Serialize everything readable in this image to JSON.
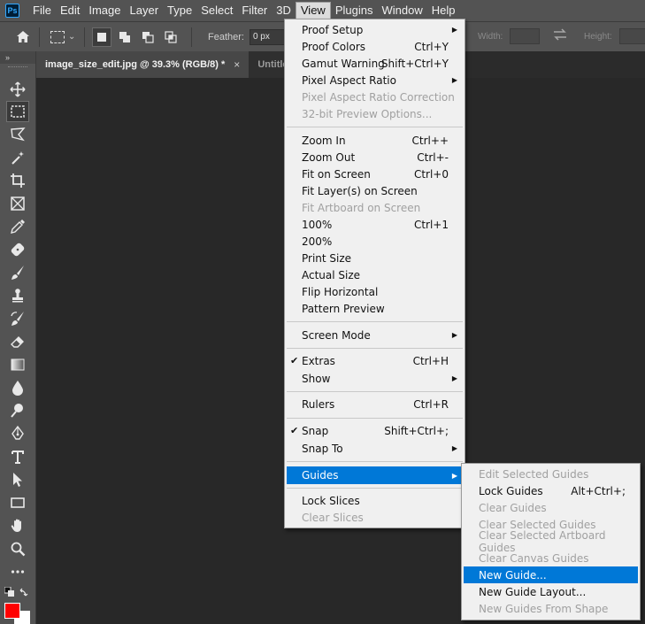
{
  "app": {
    "logo": "Ps"
  },
  "menubar": {
    "items": [
      "File",
      "Edit",
      "Image",
      "Layer",
      "Type",
      "Select",
      "Filter",
      "3D",
      "View",
      "Plugins",
      "Window",
      "Help"
    ]
  },
  "options": {
    "feather_label": "Feather:",
    "feather_value": "0 px",
    "width_label": "Width:",
    "height_label": "Height:"
  },
  "tabs": [
    {
      "label": "image_size_edit.jpg @ 39.3% (RGB/8) *",
      "close": "×"
    },
    {
      "label": "Untitled"
    }
  ],
  "toolbar": {
    "collapse": "»",
    "foreground_color": "#ff0000",
    "background_color": "#ffffff"
  },
  "view_menu": {
    "items": [
      {
        "label": "Proof Setup",
        "shortcut": "",
        "submenu": true
      },
      {
        "label": "Proof Colors",
        "shortcut": "Ctrl+Y"
      },
      {
        "label": "Gamut Warning",
        "shortcut": "Shift+Ctrl+Y"
      },
      {
        "label": "Pixel Aspect Ratio",
        "shortcut": "",
        "submenu": true
      },
      {
        "label": "Pixel Aspect Ratio Correction",
        "shortcut": "",
        "disabled": true
      },
      {
        "label": "32-bit Preview Options...",
        "shortcut": "",
        "disabled": true
      },
      {
        "label": "Zoom In",
        "shortcut": "Ctrl++"
      },
      {
        "label": "Zoom Out",
        "shortcut": "Ctrl+-"
      },
      {
        "label": "Fit on Screen",
        "shortcut": "Ctrl+0"
      },
      {
        "label": "Fit Layer(s) on Screen",
        "shortcut": ""
      },
      {
        "label": "Fit Artboard on Screen",
        "shortcut": "",
        "disabled": true
      },
      {
        "label": "100%",
        "shortcut": "Ctrl+1"
      },
      {
        "label": "200%",
        "shortcut": ""
      },
      {
        "label": "Print Size",
        "shortcut": ""
      },
      {
        "label": "Actual Size",
        "shortcut": ""
      },
      {
        "label": "Flip Horizontal",
        "shortcut": ""
      },
      {
        "label": "Pattern Preview",
        "shortcut": ""
      },
      {
        "label": "Screen Mode",
        "shortcut": "",
        "submenu": true
      },
      {
        "label": "Extras",
        "shortcut": "Ctrl+H",
        "checked": true
      },
      {
        "label": "Show",
        "shortcut": "",
        "submenu": true
      },
      {
        "label": "Rulers",
        "shortcut": "Ctrl+R"
      },
      {
        "label": "Snap",
        "shortcut": "Shift+Ctrl+;",
        "checked": true
      },
      {
        "label": "Snap To",
        "shortcut": "",
        "submenu": true
      },
      {
        "label": "Guides",
        "shortcut": "",
        "submenu": true,
        "highlighted": true
      },
      {
        "label": "Lock Slices",
        "shortcut": ""
      },
      {
        "label": "Clear Slices",
        "shortcut": "",
        "disabled": true
      }
    ],
    "check_glyph": "✔",
    "submenu_glyph": "▶"
  },
  "guides_submenu": {
    "items": [
      {
        "label": "Edit Selected Guides",
        "shortcut": "",
        "disabled": true
      },
      {
        "label": "Lock Guides",
        "shortcut": "Alt+Ctrl+;"
      },
      {
        "label": "Clear Guides",
        "shortcut": "",
        "disabled": true
      },
      {
        "label": "Clear Selected Guides",
        "shortcut": "",
        "disabled": true
      },
      {
        "label": "Clear Selected Artboard Guides",
        "shortcut": "",
        "disabled": true
      },
      {
        "label": "Clear Canvas Guides",
        "shortcut": "",
        "disabled": true
      },
      {
        "label": "New Guide...",
        "shortcut": "",
        "highlighted": true
      },
      {
        "label": "New Guide Layout...",
        "shortcut": ""
      },
      {
        "label": "New Guides From Shape",
        "shortcut": "",
        "disabled": true
      }
    ]
  },
  "colors": {
    "highlight": "#0078d7",
    "foreground_swatch": "#ff0000"
  }
}
